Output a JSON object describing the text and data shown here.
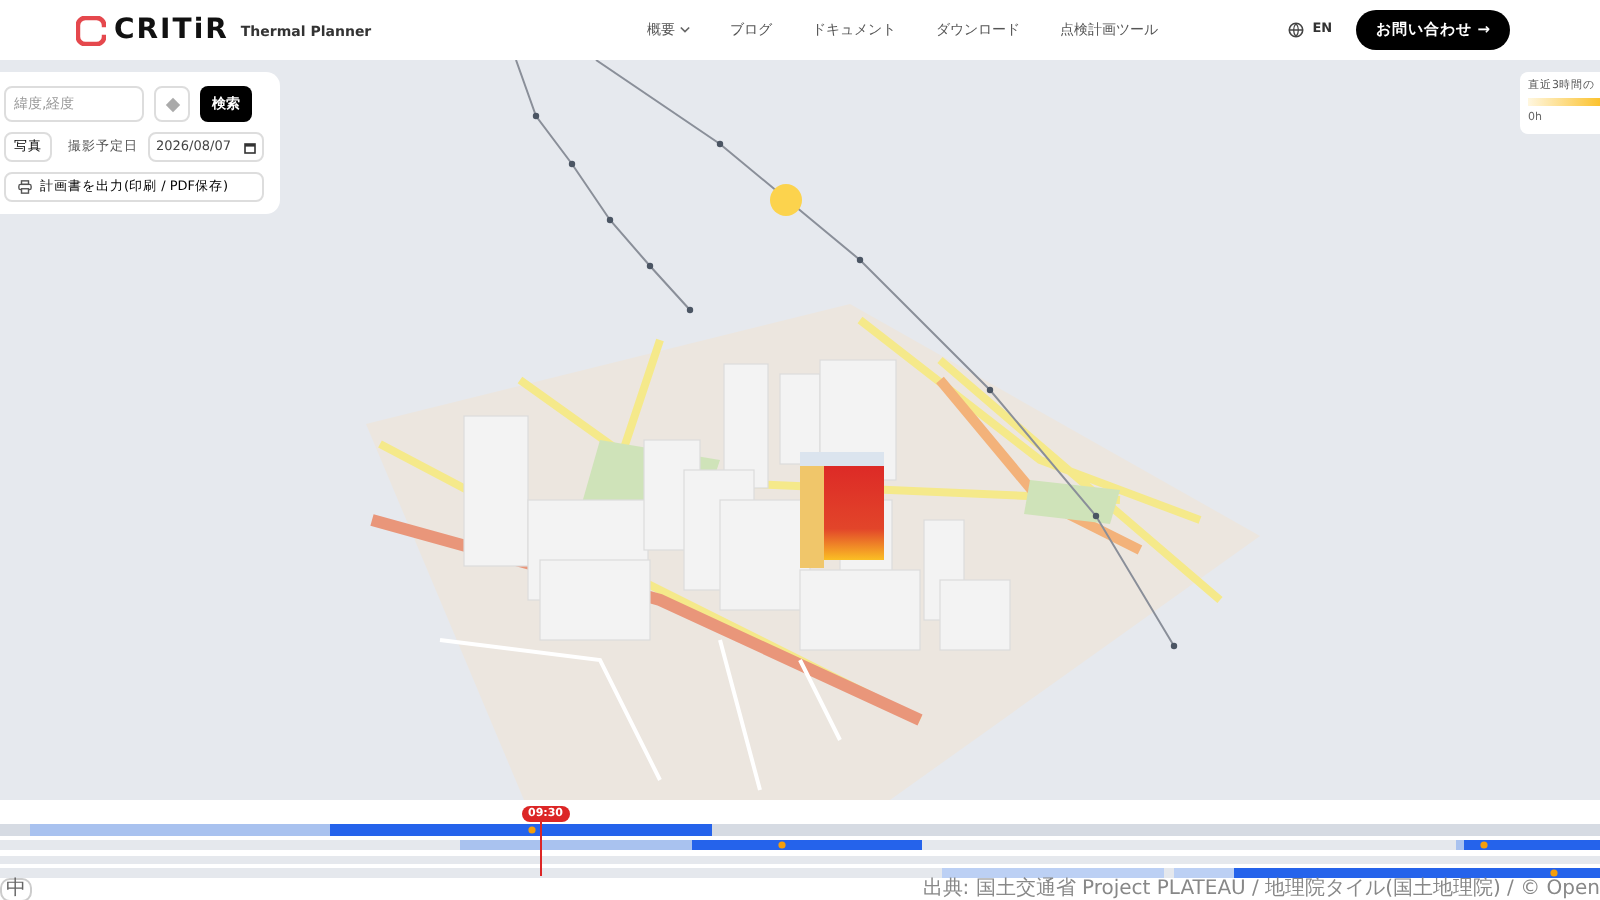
{
  "header": {
    "logo": "CRITiR",
    "subtitle": "Thermal Planner",
    "nav": [
      {
        "label": "概要",
        "dropdown": true
      },
      {
        "label": "ブログ",
        "dropdown": false
      },
      {
        "label": "ドキュメント",
        "dropdown": false
      },
      {
        "label": "ダウンロード",
        "dropdown": false
      },
      {
        "label": "点検計画ツール",
        "dropdown": false
      }
    ],
    "language": "EN",
    "contact_button": {
      "label": "お問い合わせ",
      "arrow": "→"
    }
  },
  "search_panel": {
    "coordinates_field": {
      "placeholder": "緯度,経度"
    },
    "search_button": "検索",
    "photo_button": "写真",
    "date_label": "撮影予定日",
    "date_field": {
      "value": "2026/08/07"
    },
    "export_button": "計画書を出力(印刷 / PDF保存)"
  },
  "legend": {
    "title": "直近3時間の",
    "min_label": "0h"
  },
  "timeline": {
    "current_time": "09:30",
    "mode_chip": "中"
  },
  "attribution": "出典: 国土交通省 Project PLATEAU / 地理院タイル(国土地理院) / © Open"
}
